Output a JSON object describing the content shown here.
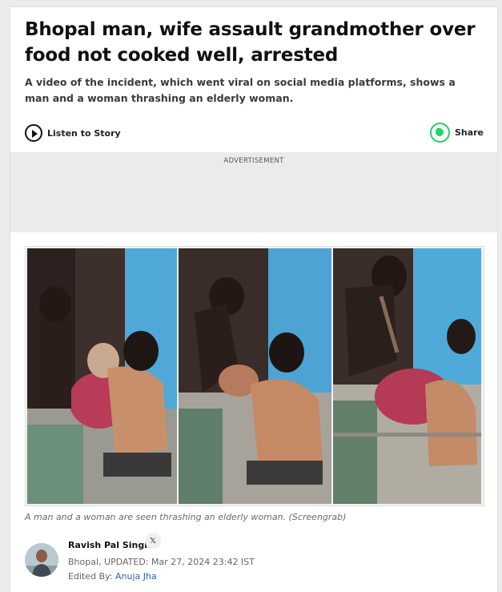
{
  "article": {
    "headline": "Bhopal man, wife assault grandmother over food not cooked well, arrested",
    "summary": "A video of the incident, which went viral on social media platforms, shows a man and a woman thrashing an elderly woman."
  },
  "toolbar": {
    "listen_label": "Listen to Story",
    "share_label": "Share",
    "play_icon": "play-circle-icon",
    "share_icon": "whatsapp-icon"
  },
  "advertisement": {
    "label": "ADVERTISEMENT"
  },
  "hero_image": {
    "caption": "A man and a woman are seen thrashing an elderly woman. (Screengrab)"
  },
  "byline": {
    "author": "Ravish Pal Singh",
    "social_icon": "𝕏",
    "location": "Bhopal,",
    "updated": "UPDATED: Mar 27, 2024 23:42 IST",
    "edited_prefix": "Edited By:",
    "editor": "Anuja Jha"
  },
  "colors": {
    "whatsapp": "#25d366",
    "link": "#2b64b1",
    "ad_background": "#ebebeb"
  }
}
